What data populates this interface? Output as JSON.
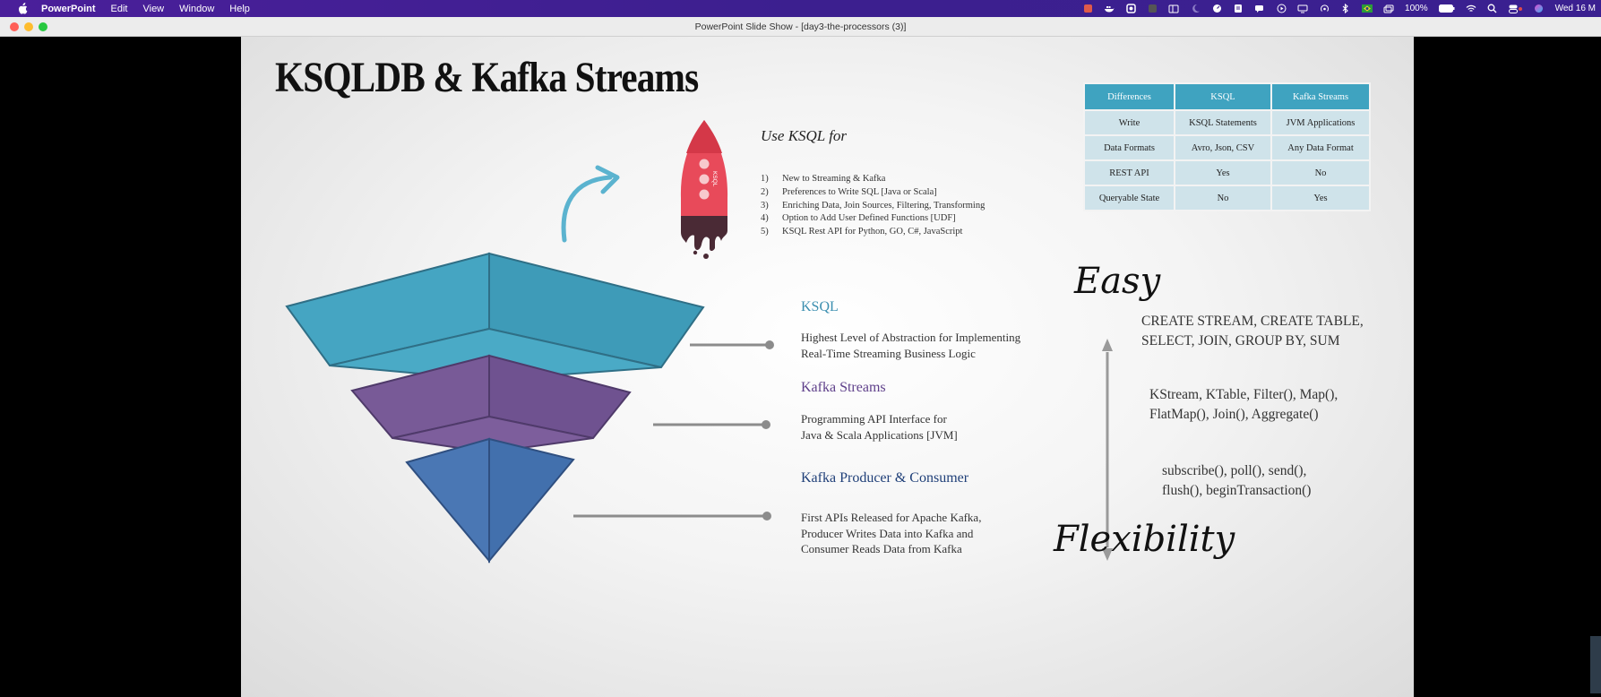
{
  "menubar": {
    "app_name": "PowerPoint",
    "menus": [
      "Edit",
      "View",
      "Window",
      "Help"
    ],
    "status": {
      "battery": "100%",
      "datetime": "Wed 16 M"
    }
  },
  "window": {
    "title": "PowerPoint Slide Show - [day3-the-processors (3)]"
  },
  "slide": {
    "title": "KSQLDB & Kafka Streams",
    "rocket_label": "KSQL",
    "use_heading": "Use KSQL for",
    "use_items": [
      {
        "num": "1)",
        "text": "New to Streaming & Kafka"
      },
      {
        "num": "2)",
        "text": "Preferences to Write SQL [Java or Scala]"
      },
      {
        "num": "3)",
        "text": "Enriching Data, Join Sources, Filtering, Transforming"
      },
      {
        "num": "4)",
        "text": "Option to Add User Defined Functions [UDF]"
      },
      {
        "num": "5)",
        "text": "KSQL Rest API for Python, GO, C#, JavaScript"
      }
    ],
    "table": {
      "headers": [
        "Differences",
        "KSQL",
        "Kafka Streams"
      ],
      "rows": [
        [
          "Write",
          "KSQL Statements",
          "JVM Applications"
        ],
        [
          "Data Formats",
          "Avro, Json, CSV",
          "Any Data Format"
        ],
        [
          "REST API",
          "Yes",
          "No"
        ],
        [
          "Queryable State",
          "No",
          "Yes"
        ]
      ]
    },
    "levels": [
      {
        "title": "KSQL",
        "color": "#3c8fb0",
        "desc1": "Highest Level of Abstraction for Implementing",
        "desc2": "Real-Time Streaming Business Logic"
      },
      {
        "title": "Kafka Streams",
        "color": "#5e3f8a",
        "desc1": "Programming API Interface for",
        "desc2": "Java & Scala Applications [JVM]"
      },
      {
        "title": "Kafka Producer & Consumer",
        "color": "#1f3f78",
        "desc1": "First APIs Released for Apache Kafka,",
        "desc2": "Producer Writes Data into Kafka and",
        "desc3": "Consumer Reads Data from Kafka"
      }
    ],
    "axis": {
      "top_label": "Easy",
      "bottom_label": "Flexibility"
    },
    "apis": [
      {
        "line1": "CREATE STREAM, CREATE TABLE,",
        "line2": "SELECT, JOIN, GROUP BY, SUM"
      },
      {
        "line1": "KStream, KTable, Filter(), Map(),",
        "line2": "FlatMap(), Join(), Aggregate()"
      },
      {
        "line1": "subscribe(), poll(), send(),",
        "line2": "flush(), beginTransaction()"
      }
    ],
    "colors": {
      "teal": "#45a5c2",
      "purple": "#785a97",
      "blue": "#4a77b4",
      "table_header": "#3fa3c0",
      "rocket": "#e84a5a"
    }
  }
}
